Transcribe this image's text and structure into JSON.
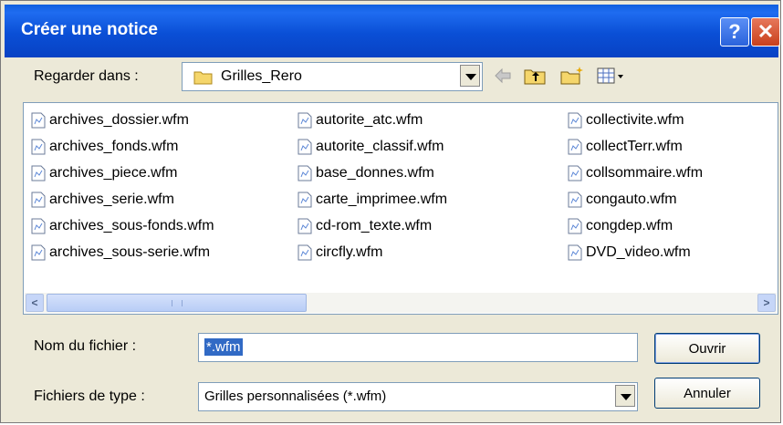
{
  "dialog": {
    "title": "Créer une notice",
    "help_glyph": "?",
    "close_glyph": "✕"
  },
  "lookin": {
    "label": "Regarder dans :",
    "value": "Grilles_Rero",
    "toolbar_icons": [
      "back-arrow-icon",
      "up-folder-icon",
      "new-folder-icon",
      "view-menu-icon"
    ]
  },
  "files": {
    "columns": [
      [
        "archives_dossier.wfm",
        "archives_fonds.wfm",
        "archives_piece.wfm",
        "archives_serie.wfm",
        "archives_sous-fonds.wfm",
        "archives_sous-serie.wfm"
      ],
      [
        "autorite_atc.wfm",
        "autorite_classif.wfm",
        "base_donnes.wfm",
        "carte_imprimee.wfm",
        "cd-rom_texte.wfm",
        "circfly.wfm"
      ],
      [
        "collectivite.wfm",
        "collectTerr.wfm",
        "collsommaire.wfm",
        "congauto.wfm",
        "congdep.wfm",
        "DVD_video.wfm"
      ]
    ],
    "scroll_left": "<",
    "scroll_right": ">"
  },
  "filename": {
    "label": "Nom du fichier :",
    "value": "*.wfm"
  },
  "filetype": {
    "label": "Fichiers de type :",
    "value": "Grilles personnalisées (*.wfm)"
  },
  "buttons": {
    "open": "Ouvrir",
    "cancel": "Annuler"
  },
  "colors": {
    "title_bar": "#0a4fd6",
    "dialog_bg": "#ece9d8",
    "selection": "#316ac5"
  }
}
